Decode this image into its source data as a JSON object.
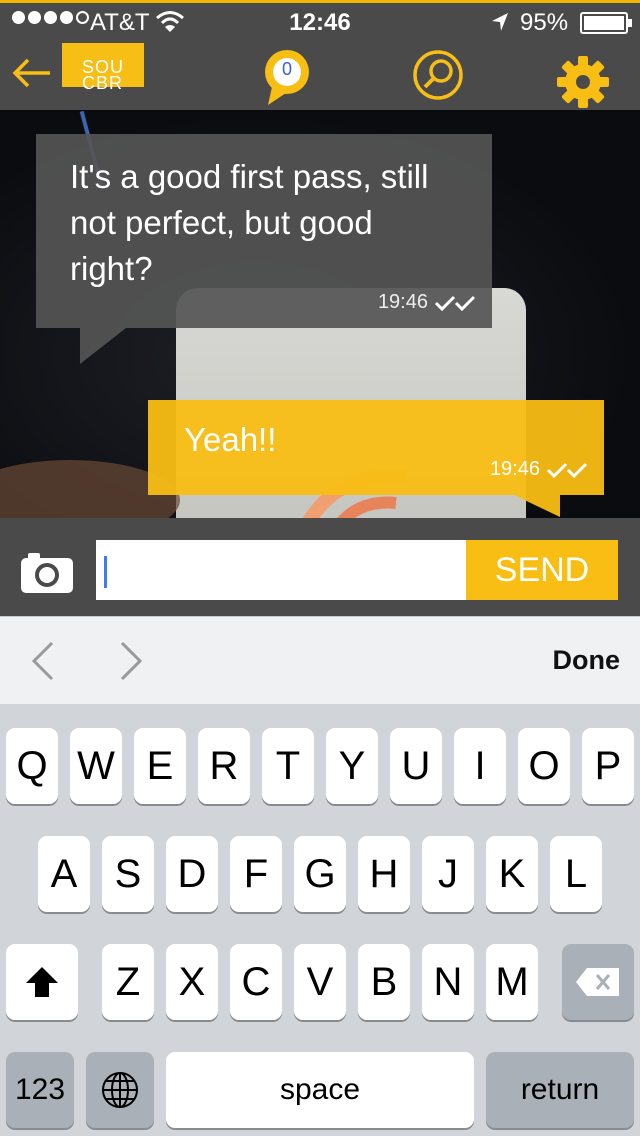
{
  "status_bar": {
    "carrier": "AT&T",
    "time": "12:46",
    "battery": "95%"
  },
  "header": {
    "logo_text": "SOU CBR",
    "chat_count": "0",
    "accent_color": "#f8be14"
  },
  "messages": [
    {
      "direction": "incoming",
      "text": "It's a good first pass, still not perfect, but good right?",
      "time": "19:46"
    },
    {
      "direction": "outgoing",
      "text": "Yeah!!",
      "time": "19:46"
    }
  ],
  "composer": {
    "value": "",
    "send_label": "SEND"
  },
  "keyboard_accessory": {
    "done_label": "Done"
  },
  "keyboard": {
    "row1": [
      "Q",
      "W",
      "E",
      "R",
      "T",
      "Y",
      "U",
      "I",
      "O",
      "P"
    ],
    "row2": [
      "A",
      "S",
      "D",
      "F",
      "G",
      "H",
      "J",
      "K",
      "L"
    ],
    "row3": [
      "Z",
      "X",
      "C",
      "V",
      "B",
      "N",
      "M"
    ],
    "numbers_label": "123",
    "space_label": "space",
    "return_label": "return"
  }
}
